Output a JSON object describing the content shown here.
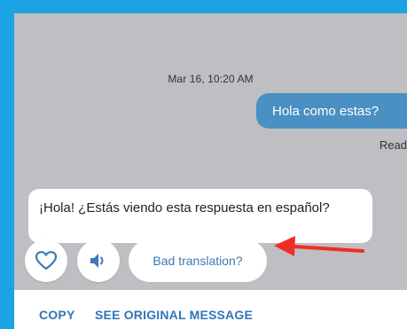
{
  "conversation": {
    "timestamp": "Mar 16, 10:20 AM",
    "outgoing_message": "Hola como estas?",
    "read_status": "Read",
    "incoming_translation": "¡Hola! ¿Estás viendo esta respuesta en español?"
  },
  "reactions": {
    "like_icon": "heart-icon",
    "speak_icon": "speaker-icon",
    "bad_translation_label": "Bad translation?"
  },
  "actions": {
    "copy_label": "COPY",
    "see_original_label": "SEE ORIGINAL MESSAGE"
  },
  "colors": {
    "frame": "#1ca3e3",
    "outgoing_bubble": "#4a90c2",
    "chat_background": "#bebec3",
    "link": "#2f76b8",
    "annotation_arrow": "#ee2d24"
  }
}
